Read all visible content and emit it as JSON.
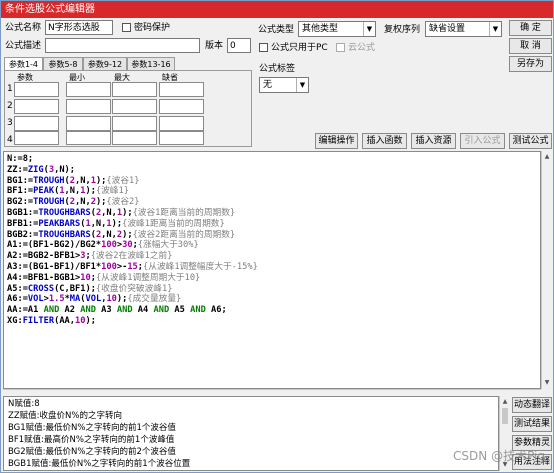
{
  "window": {
    "title": "条件选股公式编辑器"
  },
  "form": {
    "name_label": "公式名称",
    "name_value": "N字形态选股",
    "password_label": "密码保护",
    "desc_label": "公式描述",
    "desc_value": "",
    "version_label": "版本",
    "version_value": "0",
    "type_label": "公式类型",
    "type_value": "其他类型",
    "restore_label": "复权序列",
    "restore_value": "缺省设置",
    "pc_only_label": "公式只用于PC",
    "cloud_label": "云公式",
    "tag_label": "公式标签",
    "tag_value": "无"
  },
  "buttons": {
    "ok": "确 定",
    "cancel": "取 消",
    "save_as": "另存为",
    "edit_ops": "编辑操作",
    "insert_func": "插入函数",
    "insert_resource": "插入资源",
    "import_formula": "引入公式",
    "test_formula": "测试公式",
    "translate": "动态翻译",
    "test_result": "测试结果",
    "param_tips": "参数精灵",
    "usage_notes": "用法注释"
  },
  "params": {
    "tabs": [
      "参数1-4",
      "参数5-8",
      "参数9-12",
      "参数13-16"
    ],
    "headers": [
      "参数",
      "最小",
      "最大",
      "缺省"
    ],
    "rows": [
      "1",
      "2",
      "3",
      "4"
    ]
  },
  "code": [
    [
      [
        "k",
        "N:=8;"
      ]
    ],
    [
      [
        "k",
        "ZZ:="
      ],
      [
        "f",
        "ZIG"
      ],
      [
        "k",
        "("
      ],
      [
        "n",
        "3"
      ],
      [
        "k",
        ",N);"
      ]
    ],
    [
      [
        "k",
        "BG1:="
      ],
      [
        "f",
        "TROUGH"
      ],
      [
        "k",
        "("
      ],
      [
        "n",
        "2"
      ],
      [
        "k",
        ",N,"
      ],
      [
        "n",
        "1"
      ],
      [
        "k",
        ");"
      ],
      [
        "c",
        "{波谷1}"
      ]
    ],
    [
      [
        "k",
        "BF1:="
      ],
      [
        "f",
        "PEAK"
      ],
      [
        "k",
        "("
      ],
      [
        "n",
        "1"
      ],
      [
        "k",
        ",N,"
      ],
      [
        "n",
        "1"
      ],
      [
        "k",
        ");"
      ],
      [
        "c",
        "{波峰1}"
      ]
    ],
    [
      [
        "k",
        "BG2:="
      ],
      [
        "f",
        "TROUGH"
      ],
      [
        "k",
        "("
      ],
      [
        "n",
        "2"
      ],
      [
        "k",
        ",N,"
      ],
      [
        "n",
        "2"
      ],
      [
        "k",
        ");"
      ],
      [
        "c",
        "{波谷2}"
      ]
    ],
    [
      [
        "k",
        "BGB1:="
      ],
      [
        "f",
        "TROUGHBARS"
      ],
      [
        "k",
        "("
      ],
      [
        "n",
        "2"
      ],
      [
        "k",
        ",N,"
      ],
      [
        "n",
        "1"
      ],
      [
        "k",
        ");"
      ],
      [
        "c",
        "{波谷1距离当前的周期数}"
      ]
    ],
    [
      [
        "k",
        "BFB1:="
      ],
      [
        "f",
        "PEAKBARS"
      ],
      [
        "k",
        "("
      ],
      [
        "n",
        "1"
      ],
      [
        "k",
        ",N,"
      ],
      [
        "n",
        "1"
      ],
      [
        "k",
        ");"
      ],
      [
        "c",
        "{波峰1距离当前的周期数}"
      ]
    ],
    [
      [
        "k",
        "BGB2:="
      ],
      [
        "f",
        "TROUGHBARS"
      ],
      [
        "k",
        "("
      ],
      [
        "n",
        "2"
      ],
      [
        "k",
        ",N,"
      ],
      [
        "n",
        "2"
      ],
      [
        "k",
        ");"
      ],
      [
        "c",
        "{波谷2距离当前的周期数}"
      ]
    ],
    [
      [
        "k",
        "A1:=(BF1-BG2)/BG2*"
      ],
      [
        "n",
        "100"
      ],
      [
        "k",
        ">"
      ],
      [
        "n",
        "30"
      ],
      [
        "k",
        ";"
      ],
      [
        "c",
        "{涨幅大于30%}"
      ]
    ],
    [
      [
        "k",
        "A2:=BGB2-BFB1>"
      ],
      [
        "n",
        "3"
      ],
      [
        "k",
        ";"
      ],
      [
        "c",
        "{波谷2在波峰1之前}"
      ]
    ],
    [
      [
        "k",
        "A3:=(BG1-BF1)/BF1*"
      ],
      [
        "n",
        "100"
      ],
      [
        "k",
        ">-"
      ],
      [
        "n",
        "15"
      ],
      [
        "k",
        ";"
      ],
      [
        "c",
        "{从波峰1调整幅度大于-15%}"
      ]
    ],
    [
      [
        "k",
        "A4:=BFB1-BGB1>"
      ],
      [
        "n",
        "10"
      ],
      [
        "k",
        ";"
      ],
      [
        "c",
        "{从波峰1调整周期大于10}"
      ]
    ],
    [
      [
        "k",
        "A5:="
      ],
      [
        "f",
        "CROSS"
      ],
      [
        "k",
        "(C,BF1);"
      ],
      [
        "c",
        "{收盘价突破波峰1}"
      ]
    ],
    [
      [
        "k",
        "A6:="
      ],
      [
        "f",
        "VOL"
      ],
      [
        "k",
        ">"
      ],
      [
        "n",
        "1.5"
      ],
      [
        "k",
        "*"
      ],
      [
        "f",
        "MA"
      ],
      [
        "k",
        "("
      ],
      [
        "f",
        "VOL"
      ],
      [
        "k",
        ","
      ],
      [
        "n",
        "10"
      ],
      [
        "k",
        ");"
      ],
      [
        "c",
        "{成交量放量}"
      ]
    ],
    [
      [
        "k",
        "AA:=A1 "
      ],
      [
        "o",
        "AND"
      ],
      [
        "k",
        " A2 "
      ],
      [
        "o",
        "AND"
      ],
      [
        "k",
        " A3 "
      ],
      [
        "o",
        "AND"
      ],
      [
        "k",
        " A4 "
      ],
      [
        "o",
        "AND"
      ],
      [
        "k",
        " A5 "
      ],
      [
        "o",
        "AND"
      ],
      [
        "k",
        " A6;"
      ]
    ],
    [
      [
        "k",
        "XG:"
      ],
      [
        "f",
        "FILTER"
      ],
      [
        "k",
        "(AA,"
      ],
      [
        "n",
        "10"
      ],
      [
        "k",
        ");"
      ]
    ]
  ],
  "output": [
    "N赋值:8",
    "ZZ赋值:收盘价N%的之字转向",
    "BG1赋值:最低价N%之字转向的前1个波谷值",
    "BF1赋值:最高价N%之字转向的前1个波峰值",
    "BG2赋值:最低价N%之字转向的前2个波谷值",
    "BGB1赋值:最低价N%之字转向的前1个波谷位置"
  ],
  "watermark": "CSDN @技术Pig"
}
